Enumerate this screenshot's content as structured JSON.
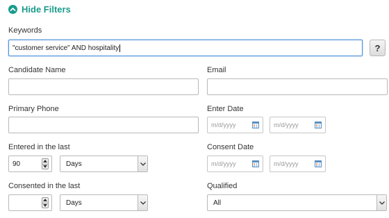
{
  "filters": {
    "toggle_label": "Hide Filters",
    "toggle_icon": "chevron-up-circle-icon",
    "accent_color": "#1a9b8c",
    "keywords": {
      "label": "Keywords",
      "value": "\"customer service\" AND hospitality",
      "help_label": "?"
    },
    "candidate_name": {
      "label": "Candidate Name",
      "value": ""
    },
    "email": {
      "label": "Email",
      "value": ""
    },
    "primary_phone": {
      "label": "Primary Phone",
      "value": ""
    },
    "enter_date": {
      "label": "Enter Date",
      "from_placeholder": "m/d/yyyy",
      "to_placeholder": "m/d/yyyy"
    },
    "entered_in_last": {
      "label": "Entered in the last",
      "value": "90",
      "unit": "Days"
    },
    "consent_date": {
      "label": "Consent Date",
      "from_placeholder": "m/d/yyyy",
      "to_placeholder": "m/d/yyyy"
    },
    "consented_in_last": {
      "label": "Consented in the last",
      "value": "",
      "unit": "Days"
    },
    "qualified": {
      "label": "Qualified",
      "value": "All"
    }
  }
}
